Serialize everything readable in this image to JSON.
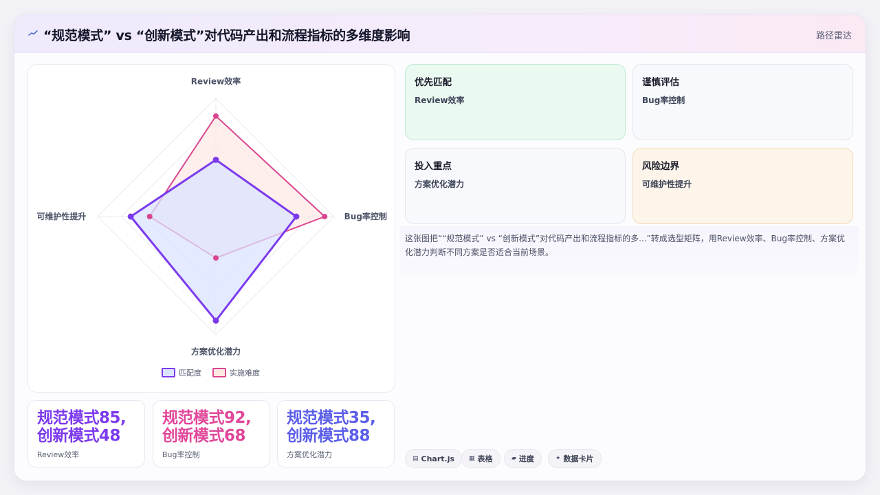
{
  "header": {
    "title": "“规范模式” vs “创新模式”对代码产出和流程指标的多维度影响",
    "right_label": "路径雷达",
    "icon": "trend-line-icon"
  },
  "chart_data": {
    "type": "radar",
    "axes": [
      "Review效率",
      "Bug率控制",
      "方案优化潜力",
      "可维护性提升"
    ],
    "series": [
      {
        "name": "匹配度",
        "values": [
          48,
          68,
          88,
          72
        ],
        "color": "#7c3aed",
        "fill": "#dbe3ff"
      },
      {
        "name": "实施难度",
        "values": [
          85,
          92,
          35,
          56
        ],
        "color": "#d9468f",
        "fill": "#fde7e3"
      }
    ],
    "range": [
      0,
      100
    ],
    "legend_position": "bottom",
    "grid": true
  },
  "stats": [
    {
      "value": "规范模式85,创新模式48",
      "label": "Review效率",
      "color": "#7c3aed"
    },
    {
      "value": "规范模式92,创新模式68",
      "label": "Bug率控制",
      "color": "#e0479a"
    },
    {
      "value": "规范模式35,创新模式88",
      "label": "方案优化潜力",
      "color": "#5b5ee8"
    }
  ],
  "tiles": [
    {
      "title": "优先匹配",
      "sub": "Review效率",
      "bg": "#ebfaf1",
      "border": "#bfe9d2"
    },
    {
      "title": "谨慎评估",
      "sub": "Bug率控制",
      "bg": "#f8f9fc",
      "border": "#e3e6f0"
    },
    {
      "title": "投入重点",
      "sub": "方案优化潜力",
      "bg": "#f8f9fc",
      "border": "#e3e6f0"
    },
    {
      "title": "风险边界",
      "sub": "可维护性提升",
      "bg": "#fdf5ea",
      "border": "#f3d9b6"
    }
  ],
  "description": "这张图把““规范模式” vs “创新模式”对代码产出和流程指标的多...”转成选型矩阵，用Review效率、Bug率控制、方案优化潜力判断不同方案是否适合当前场景。",
  "chips": [
    {
      "icon": "▤",
      "label": "Chart.js"
    },
    {
      "icon": "▦",
      "label": "表格"
    },
    {
      "icon": "▰",
      "label": "进度"
    },
    {
      "icon": "✦",
      "label": "数据卡片"
    }
  ]
}
